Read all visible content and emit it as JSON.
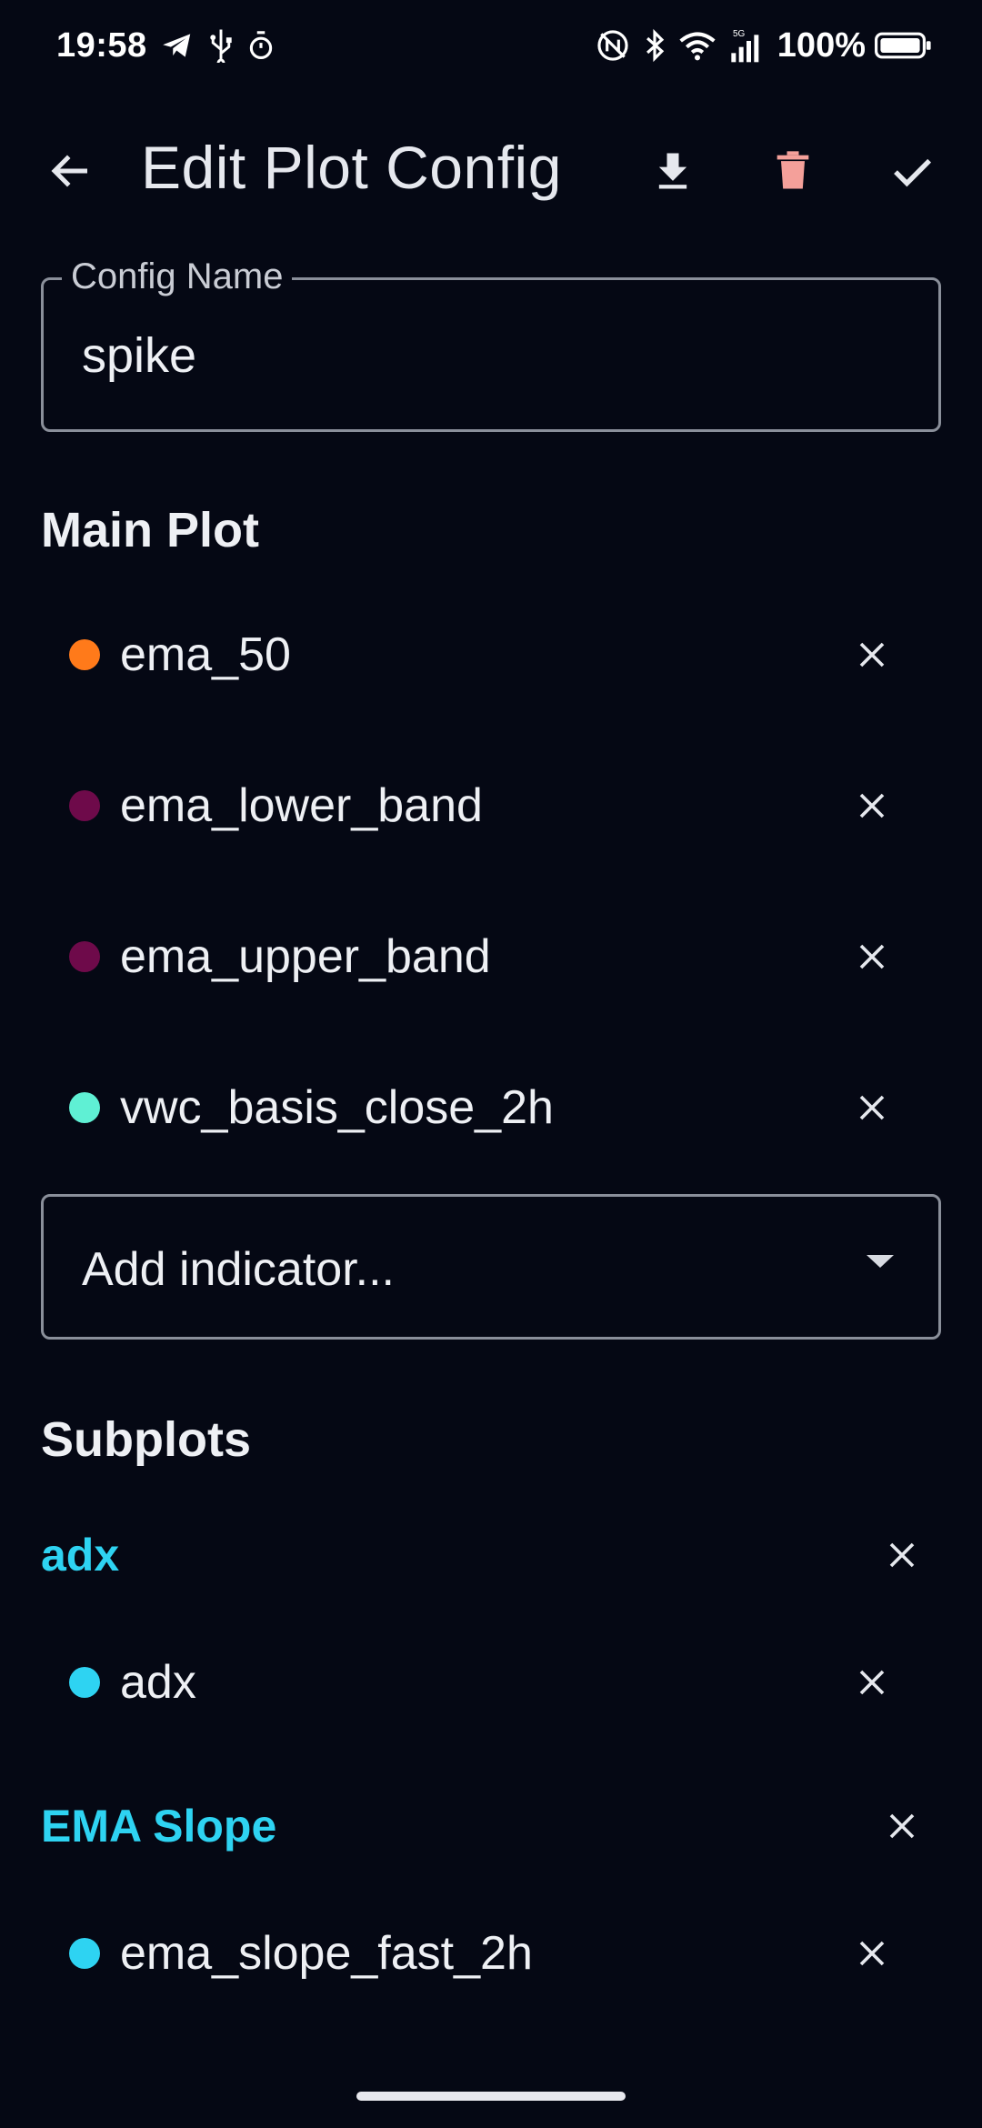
{
  "status_bar": {
    "time": "19:58",
    "network_label": "5G",
    "battery_percent": "100%"
  },
  "app_bar": {
    "title": "Edit Plot Config",
    "icons": [
      "back-arrow-icon",
      "download-icon",
      "delete-icon",
      "check-icon"
    ],
    "delete_color": "#f4a09a"
  },
  "config_name": {
    "label": "Config Name",
    "value": "spike"
  },
  "main_plot": {
    "title": "Main Plot",
    "indicators": [
      {
        "name": "ema_50",
        "color": "#ff7a1a"
      },
      {
        "name": "ema_lower_band",
        "color": "#6e0a4a"
      },
      {
        "name": "ema_upper_band",
        "color": "#6e0a4a"
      },
      {
        "name": "vwc_basis_close_2h",
        "color": "#5ff0d4"
      }
    ],
    "add_indicator_placeholder": "Add indicator..."
  },
  "subplots": {
    "title": "Subplots",
    "groups": [
      {
        "name": "adx",
        "indicators": [
          {
            "name": "adx",
            "color": "#2ed3f2"
          }
        ]
      },
      {
        "name": "EMA Slope",
        "indicators": [
          {
            "name": "ema_slope_fast_2h",
            "color": "#2ed3f2"
          }
        ]
      }
    ]
  },
  "colors": {
    "background": "#050814",
    "accent": "#2ed3f2"
  }
}
